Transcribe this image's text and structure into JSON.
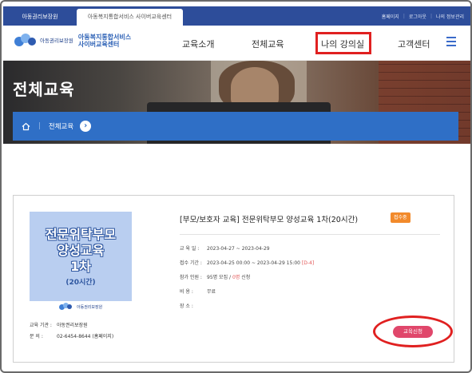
{
  "utility_bar": {
    "tab_1": "아동권리보장원",
    "tab_2": "아동복지통합서비스 사이버교육센터",
    "links": [
      "홈페이지",
      "로그아웃",
      "나의 정보관리"
    ]
  },
  "header": {
    "logo_org": "아동권리보장원",
    "logo_service_line1": "아동복지통합서비스",
    "logo_service_line2": "사이버교육센터",
    "nav": [
      "교육소개",
      "전체교육",
      "나의 강의실",
      "고객센터"
    ]
  },
  "hero": {
    "title": "전체교육"
  },
  "breadcrumb": {
    "current": "전체교육"
  },
  "course": {
    "thumbnail_line1": "전문위탁부모",
    "thumbnail_line2": "양성교육",
    "thumbnail_line3": "1차",
    "thumbnail_line4": "(20시간)",
    "thumbnail_org": "아동권리보장원",
    "title": "[부모/보호자 교육] 전문위탁부모 양성교육 1차(20시간)",
    "badge": "접수중",
    "edu_period_label": "교 육 일 :",
    "edu_period_value": "2023-04-27 ~ 2023-04-29",
    "apply_period_label": "접수 기간 :",
    "apply_period_value": "2023-04-25 00:00 ~ 2023-04-29 15:00",
    "apply_period_dday": "[D-4]",
    "capacity_label": "참가 인원 :",
    "capacity_value_prefix": "95명 모집 /",
    "capacity_current": "0명",
    "capacity_value_suffix": "신청",
    "cost_label": "비 용 :",
    "cost_value": "무료",
    "place_label": "장 소 :",
    "place_value": "",
    "org_label": "교육 기관 :",
    "org_value": "아동권리보장원",
    "contact_label": "문 의 :",
    "contact_value": "02-6454-8644 (홈페이지)",
    "apply_button": "교육신청"
  }
}
